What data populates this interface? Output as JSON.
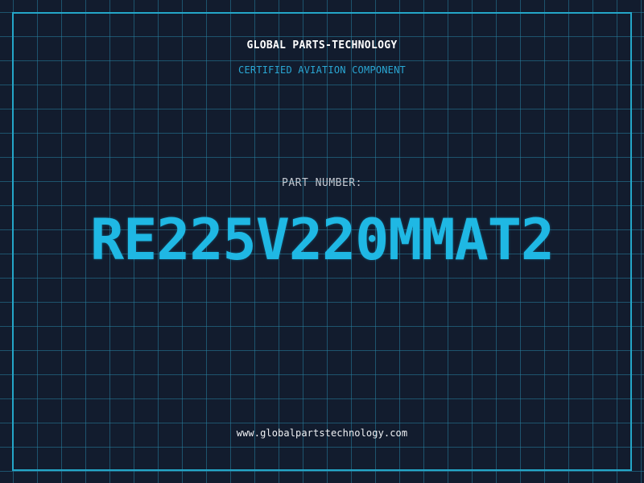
{
  "header": {
    "company": "GLOBAL PARTS-TECHNOLOGY",
    "subtitle": "CERTIFIED AVIATION COMPONENT"
  },
  "part": {
    "label": "PART NUMBER:",
    "number": "RE225V220MMAT2"
  },
  "footer": {
    "website": "www.globalpartstechnology.com"
  },
  "colors": {
    "background": "#121c2e",
    "grid": "#2780a0",
    "frame": "#24a6c8",
    "accent": "#1fb8e4",
    "subtitle": "#2aa7d4",
    "text": "#ffffff",
    "label": "#c3c8d0"
  }
}
